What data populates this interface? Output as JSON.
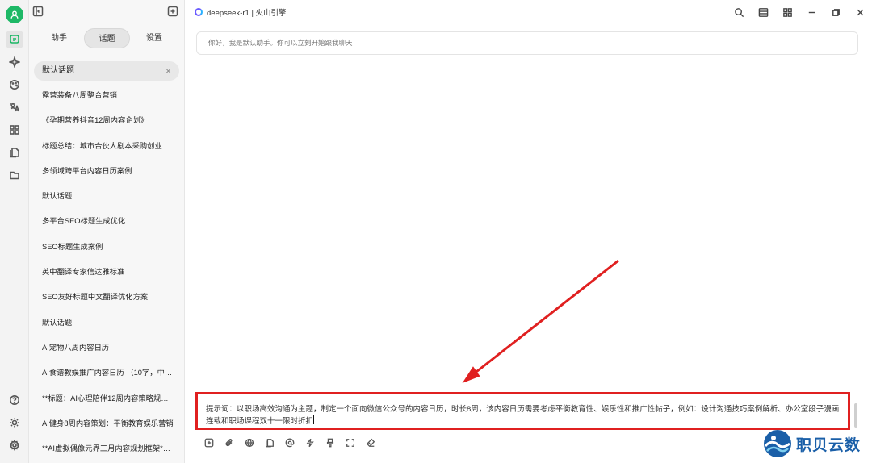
{
  "topics_panel": {
    "tabs": [
      {
        "label": "助手"
      },
      {
        "label": "话题"
      },
      {
        "label": "设置"
      }
    ],
    "current_topic": "默认话题",
    "topics": [
      "露营装备八周整合营销",
      "《孕期营养抖音12周内容企划》",
      "标题总结：城市合伙人剧本采购创业…",
      "多领域跨平台内容日历案例",
      "默认话题",
      "多平台SEO标题生成优化",
      "SEO标题生成案例",
      "英中翻译专家信达雅标准",
      "SEO友好标题中文翻译优化方案",
      "默认话题",
      "AI宠物八周内容日历",
      "AI食谱教娱推广内容日历 （10字，中…",
      "**标题：AI心理陪伴12周内容策略规…",
      "AI健身8周内容策划：平衡教育娱乐营销",
      "**AI虚拟偶像元界三月内容规划框架*…"
    ]
  },
  "header": {
    "model_label": "deepseek-r1 | 火山引擎"
  },
  "chat": {
    "welcome": "你好，我是默认助手。你可以立刻开始跟我聊天"
  },
  "input": {
    "text": "提示词：以职场高效沟通为主题，制定一个面向微信公众号的内容日历，时长8周，该内容日历需要考虑平衡教育性、娱乐性和推广性帖子，例如：设计沟通技巧案例解析、办公室段子漫画连载和职场课程双十一限时折扣"
  },
  "watermark": {
    "text": "职贝云数"
  },
  "colors": {
    "accent_green": "#1db866",
    "annotation_red": "#e02020",
    "watermark_blue": "#1a5fa8"
  }
}
